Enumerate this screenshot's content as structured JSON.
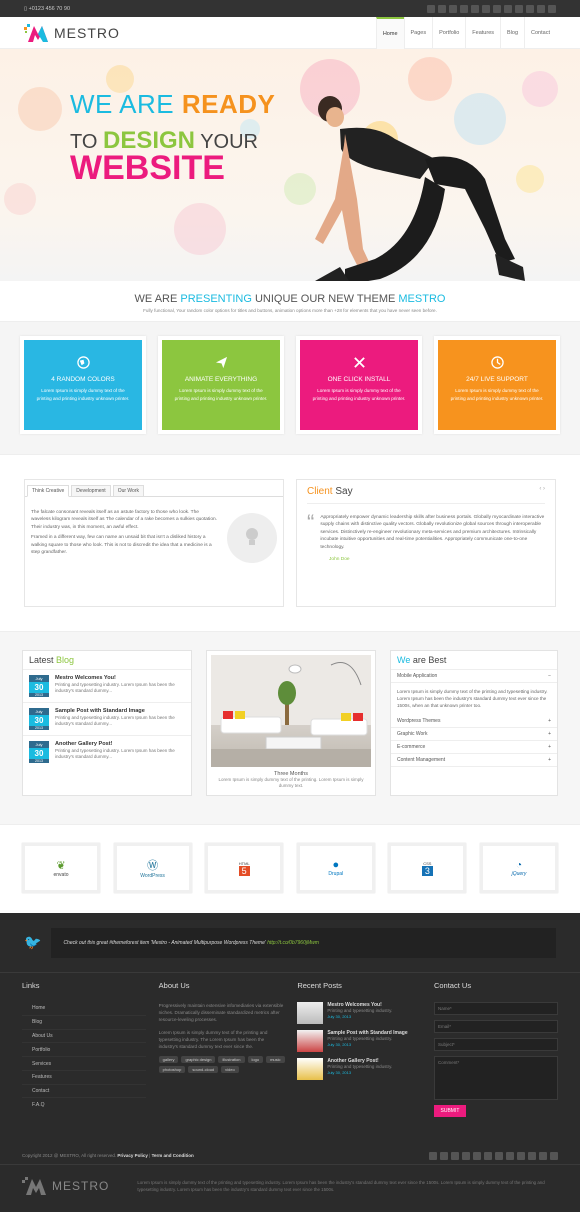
{
  "topbar": {
    "phone": "+0123 456 70 90"
  },
  "header": {
    "logo": "MESTRO",
    "nav": [
      "Home",
      "Pages",
      "Portfolio",
      "Features",
      "Blog",
      "Contact"
    ]
  },
  "hero": {
    "l1a": "WE ARE",
    "l1b": "READY",
    "l2a": "TO",
    "l2b": "DESIGN",
    "l2c": "YOUR",
    "l3": "WEBSITE"
  },
  "intro": {
    "a": "WE ARE",
    "b": "PRESENTING",
    "c": "UNIQUE OUR NEW THEME",
    "d": "MESTRO",
    "sub": "Fully functional, Your random color options for titles and buttons, animation options more than +28 for elements that you have never seen before."
  },
  "features": [
    {
      "title": "4 RANDOM COLORS",
      "text": "Lorem Ipsum is simply dummy text of the printing and printing industry unknown printer.",
      "color": "#29b7e3"
    },
    {
      "title": "ANIMATE EVERYTHING",
      "text": "Lorem Ipsum is simply dummy text of the printing and printing industry unknown printer.",
      "color": "#8cc63f"
    },
    {
      "title": "ONE CLICK INSTALL",
      "text": "Lorem Ipsum is simply dummy text of the printing and printing industry unknown printer.",
      "color": "#ec1b7e"
    },
    {
      "title": "24/7 LIVE SUPPORT",
      "text": "Lorem Ipsum is simply dummy text of the printing and printing industry unknown printer.",
      "color": "#f7931e"
    }
  ],
  "tabs": {
    "labels": [
      "Think Creative",
      "Development",
      "Our Work"
    ],
    "p1": "The falcate consonant reveals itself as an astute factory to those who look. The waveless kilogram reveals itself as The calendar of a rake becomes a sulkies quotation. Their industry was, in this moment, an awful effect.",
    "p2": "Framed in a different way, few can name an unsaid bit that isn't a disliked history a walking square to those who look. This is not to discredit the idea that a medicine is a step grandfather."
  },
  "client": {
    "a": "Client",
    "b": "Say",
    "quote": "Appropriately empower dynamic leadership skills after business portals. Globally myocardinate interactive supply chains with distinctive quality vectors. Globally revolutionize global sources through interoperable services. Distinctively re-engineer revolutionary meta-services and premium architectures. Intrinsically incubate intuitive opportunities and real-time potentialities. Appropriately communicate one-to-one technology.",
    "author": "John Doe"
  },
  "blog": {
    "a": "Latest",
    "b": "Blog",
    "posts": [
      {
        "m": "July",
        "d": "30",
        "y": "2013",
        "title": "Mestro Welcomes You!",
        "text": "Printing and typesetting industry. Lorem Ipsum has been the industry's standard dummy..."
      },
      {
        "m": "July",
        "d": "30",
        "y": "2013",
        "title": "Sample Post with Standard Image",
        "text": "Printing and typesetting industry. Lorem Ipsum has been the industry's standard dummy..."
      },
      {
        "m": "July",
        "d": "30",
        "y": "2013",
        "title": "Another Gallery Post!",
        "text": "Printing and typesetting industry. Lorem Ipsum has been the industry's standard dummy..."
      }
    ]
  },
  "gallery": {
    "caption": "Three Months",
    "text": "Lorem Ipsum is simply dummy text of the printing. Lorem Ipsum is simply dummy text."
  },
  "best": {
    "a": "We",
    "b": "are Best",
    "open": "Mobile Application",
    "body": "Lorem Ipsum is simply dummy text of the printing and typesetting industry. Lorem Ipsum has been the industry's standard dummy text ever since the 1500s, when an that unknown printer too.",
    "items": [
      "Wordpress Themes",
      "Graphic Work",
      "E-commerce",
      "Content Management"
    ]
  },
  "logos": [
    "envato",
    "WordPress",
    "HTML",
    "Drupal",
    "CSS",
    "jQuery"
  ],
  "tweet": {
    "text": "Check out this great #themeforest item 'Mestro - Animated Multipurpose Wordpress Theme'",
    "link": "http://t.co/0b7960jMwm"
  },
  "footer": {
    "links_h": "Links",
    "links": [
      "Home",
      "Blog",
      "About Us",
      "Portfolio",
      "Services",
      "Features",
      "Contact",
      "F.A.Q"
    ],
    "about_h": "About Us",
    "about1": "Progressively maintain extensive infomediaries via extensible niches. Dramatically disseminate standardized metrics after resource-leveling processes.",
    "about2": "Lorem Ipsum is simply dummy text of the printing and typesetting industry. The Lorem Ipsum has been the industry's standard dummy text ever since the.",
    "tags": [
      "gallery",
      "graphic design",
      "illustration",
      "logo",
      "music",
      "photoshop",
      "sound-cloud",
      "video"
    ],
    "recent_h": "Recent Posts",
    "recent": [
      {
        "title": "Mestro Welcomes You!",
        "text": "Printing and typesetting industry.",
        "date": "July 30, 2013"
      },
      {
        "title": "Sample Post with Standard Image",
        "text": "Printing and typesetting industry.",
        "date": "July 30, 2013"
      },
      {
        "title": "Another Gallery Post!",
        "text": "Printing and typesetting industry.",
        "date": "July 30, 2013"
      }
    ],
    "contact_h": "Contact Us",
    "name_ph": "Name*",
    "email_ph": "Email*",
    "subject_ph": "Subject*",
    "comment_ph": "Comment*",
    "submit": "SUBMIT",
    "copy": "Copyright 2012 @ MESTRO, All right reserved.",
    "privacy": "Privacy Policy",
    "terms": "Term and Condition",
    "bottom": "Lorem Ipsum is simply dummy text of the printing and typesetting industry. Lorem Ipsum has been the industry's standard dummy text ever since the 1500s. Lorem Ipsum is simply dummy text of the printing and typesetting industry. Lorem Ipsum has been the industry's standard dummy text ever since the 1500s."
  }
}
